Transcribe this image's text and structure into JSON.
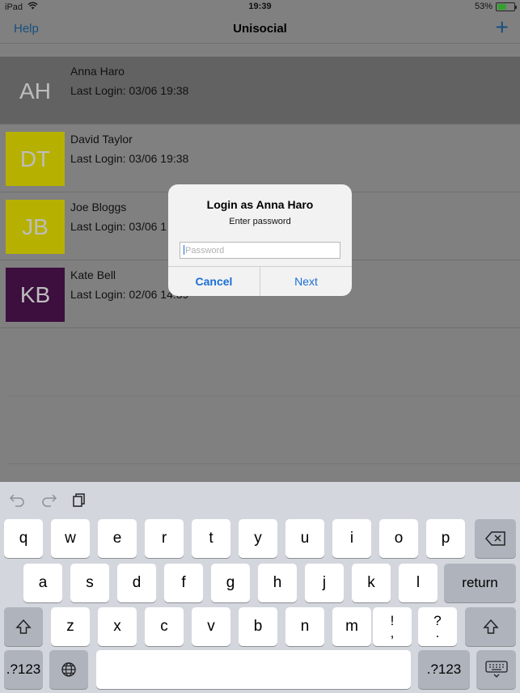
{
  "status_bar": {
    "device": "iPad",
    "time": "19:39",
    "battery": "53%",
    "battery_level": 0.53
  },
  "nav": {
    "help_label": "Help",
    "title": "Unisocial",
    "add_label": "+"
  },
  "users": [
    {
      "initials": "AH",
      "name": "Anna Haro",
      "last_login": "Last Login: 03/06 19:38",
      "color": "#626262",
      "selected": true
    },
    {
      "initials": "DT",
      "name": "David Taylor",
      "last_login": "Last Login: 03/06 19:38",
      "color": "#b6b000"
    },
    {
      "initials": "JB",
      "name": "Joe Bloggs",
      "last_login": "Last Login: 03/06 1",
      "color": "#b6b000"
    },
    {
      "initials": "KB",
      "name": "Kate Bell",
      "last_login": "Last Login: 02/06 14:39",
      "color": "#3c0f3e"
    }
  ],
  "alert": {
    "title": "Login as Anna Haro",
    "message": "Enter password",
    "password_placeholder": "Password",
    "cancel_label": "Cancel",
    "next_label": "Next"
  },
  "keyboard": {
    "row1": [
      "q",
      "w",
      "e",
      "r",
      "t",
      "y",
      "u",
      "i",
      "o",
      "p"
    ],
    "row2": [
      "a",
      "s",
      "d",
      "f",
      "g",
      "h",
      "j",
      "k",
      "l"
    ],
    "row3": [
      "z",
      "x",
      "c",
      "v",
      "b",
      "n",
      "m"
    ],
    "return_label": "return",
    "numbers_label": ".?123",
    "punct1_top": "!",
    "punct1_bottom": ",",
    "punct2_top": "?",
    "punct2_bottom": "."
  },
  "icons": {
    "wifi": "wifi-icon",
    "undo": "undo-icon",
    "redo": "redo-icon",
    "paste": "paste-icon",
    "delete": "delete-icon",
    "shift": "shift-icon",
    "globe": "globe-icon",
    "dismiss_keyboard": "keyboard-dismiss-icon"
  }
}
